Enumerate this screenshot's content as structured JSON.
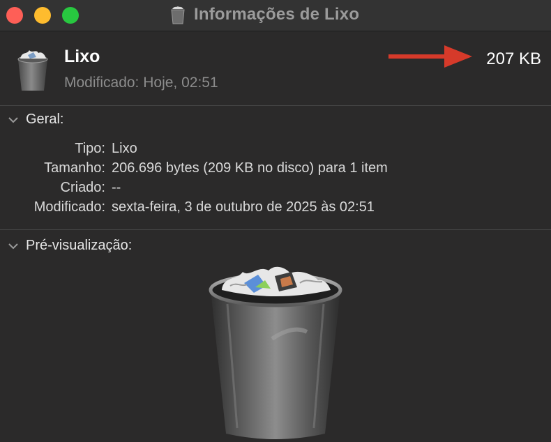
{
  "window": {
    "title": "Informações de Lixo"
  },
  "header": {
    "name": "Lixo",
    "modified": "Modificado: Hoje, 02:51",
    "size": "207 KB"
  },
  "sections": {
    "general": {
      "heading": "Geral:",
      "rows": [
        {
          "label": "Tipo:",
          "value": "Lixo"
        },
        {
          "label": "Tamanho:",
          "value": "206.696 bytes (209 KB no disco) para 1 item"
        },
        {
          "label": "Criado:",
          "value": "--"
        },
        {
          "label": "Modificado:",
          "value": "sexta-feira, 3 de outubro de 2025 às 02:51"
        }
      ]
    },
    "preview": {
      "heading": "Pré-visualização:"
    }
  },
  "icons": {
    "trash": "trash-full-icon",
    "annotation_arrow": "red-arrow-icon",
    "disclosure": "chevron-down-icon"
  },
  "colors": {
    "close": "#fe5f57",
    "minimize": "#febc2e",
    "zoom": "#28c840",
    "arrow": "#d63a2a"
  }
}
